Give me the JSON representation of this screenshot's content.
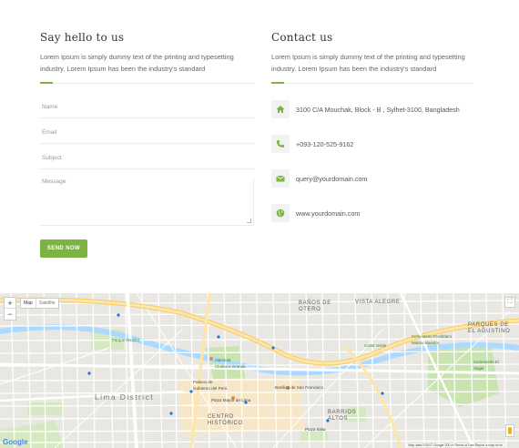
{
  "hello": {
    "heading": "Say hello to us",
    "paragraph": "Lorem Ipsum is simply dummy text of the printing and typesetting industry. Lorem Ipsum has been the industry's standard",
    "form": {
      "name_placeholder": "Name",
      "email_placeholder": "Email",
      "subject_placeholder": "Subject",
      "message_placeholder": "Message",
      "send_label": "Send Now"
    }
  },
  "contact": {
    "heading": "Contact us",
    "paragraph": "Lorem Ipsum is simply dummy text of the printing and typesetting industry. Lorem Ipsum has been the industry's standard",
    "items": [
      {
        "icon": "home-icon",
        "text": "3100 C/A Mouchak, Block - B , Sylhet-3100, Bangladesh"
      },
      {
        "icon": "phone-icon",
        "text": "+093-120-525-9162"
      },
      {
        "icon": "envelope-icon",
        "text": "query@yourdomain.com"
      },
      {
        "icon": "globe-icon",
        "text": "www.yourdomain.com"
      }
    ]
  },
  "colors": {
    "accent": "#7cb342",
    "icon_bg": "#f2f2f2"
  },
  "map": {
    "zoom_in": "+",
    "zoom_out": "−",
    "type_map": "Map",
    "type_satellite": "Satellite",
    "fullscreen": "⛶",
    "google": "Google",
    "terms": "Map data ©2017 Google   200 m   Terms of Use   Report a map error",
    "labels": {
      "vista_alegre": "VISTA ALEGRE",
      "banos_de_otero": "BAÑOS DE OTERO",
      "parques_de_el_agustino": "PARQUES DE EL AGUSTINO",
      "lima_district": "Lima District",
      "centro_historico": "CENTRO HISTÓRICO",
      "barrios_altos": "BARRIOS ALTOS",
      "alameda_chabuca_granda": "Alameda Chabuca Granda",
      "palacio_de_gobierno": "Palacio de Gobierno del Perú",
      "plaza_mayor": "Plaza Mayor de Lima",
      "basilica_san_francisco": "Basílica de San Francisco",
      "plaza_italia": "Plaza Italia",
      "cementerio_presbitero": "Cementerio Presbítero Matías Maestro",
      "cementerio_el_angel": "Cementerio El Ángel",
      "parque_mirador": "Parque Mirador",
      "costa_verde": "Costa Verde"
    }
  }
}
